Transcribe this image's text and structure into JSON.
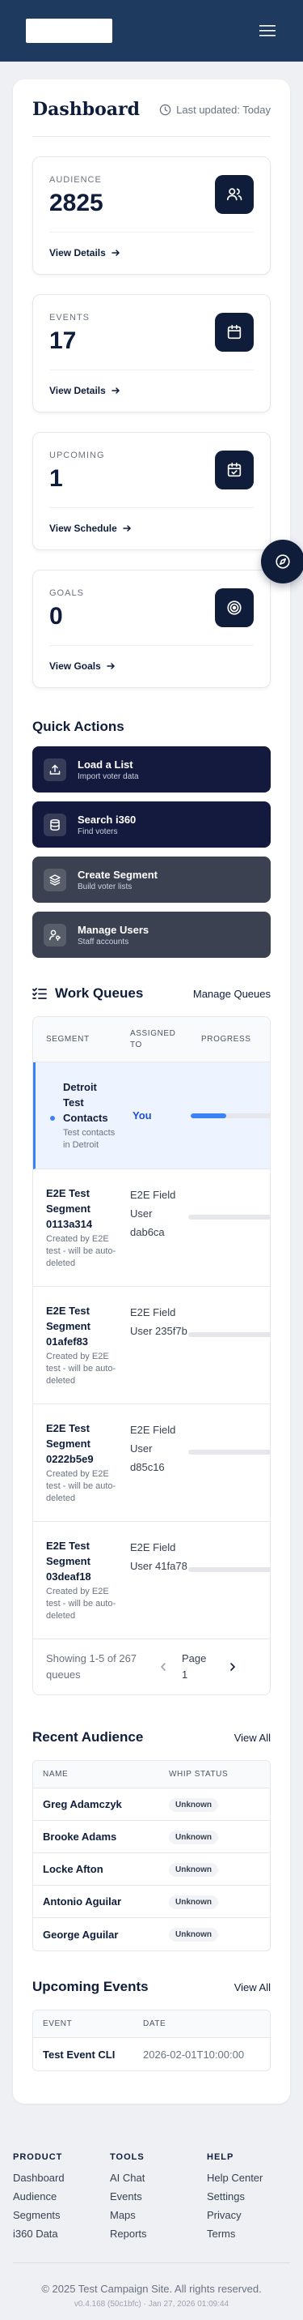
{
  "header": {
    "menu_icon": "hamburger-menu-icon"
  },
  "dashboard": {
    "title": "Dashboard",
    "last_updated": "Last updated: Today"
  },
  "stats": [
    {
      "label": "AUDIENCE",
      "value": "2825",
      "link": "View Details",
      "icon": "users-icon"
    },
    {
      "label": "EVENTS",
      "value": "17",
      "link": "View Details",
      "icon": "calendar-icon"
    },
    {
      "label": "UPCOMING",
      "value": "1",
      "link": "View Schedule",
      "icon": "calendar-check-icon"
    },
    {
      "label": "GOALS",
      "value": "0",
      "link": "View Goals",
      "icon": "target-icon"
    }
  ],
  "quick_actions": {
    "title": "Quick Actions",
    "items": [
      {
        "label": "Load a List",
        "sub": "Import voter data",
        "icon": "upload-icon"
      },
      {
        "label": "Search i360",
        "sub": "Find voters",
        "icon": "database-icon"
      },
      {
        "label": "Create Segment",
        "sub": "Build voter lists",
        "icon": "layers-icon"
      },
      {
        "label": "Manage Users",
        "sub": "Staff accounts",
        "icon": "user-key-icon"
      }
    ]
  },
  "work_queues": {
    "title": "Work Queues",
    "manage_link": "Manage Queues",
    "columns": [
      "SEGMENT",
      "ASSIGNED TO",
      "PROGRESS"
    ],
    "rows": [
      {
        "name": "Detroit Test Contacts",
        "desc": "Test contacts in Detroit",
        "assigned": "You",
        "progress": 0.45
      },
      {
        "name": "E2E Test Segment 0113a314",
        "desc": "Created by E2E test - will be auto-deleted",
        "assigned": "E2E Field User dab6ca",
        "progress": 0
      },
      {
        "name": "E2E Test Segment 01afef83",
        "desc": "Created by E2E test - will be auto-deleted",
        "assigned": "E2E Field User 235f7b",
        "progress": 0
      },
      {
        "name": "E2E Test Segment 0222b5e9",
        "desc": "Created by E2E test - will be auto-deleted",
        "assigned": "E2E Field User d85c16",
        "progress": 0
      },
      {
        "name": "E2E Test Segment 03deaf18",
        "desc": "Created by E2E test - will be auto-deleted",
        "assigned": "E2E Field User 41fa78",
        "progress": 0
      }
    ],
    "showing": "Showing 1-5 of 267 queues",
    "page": "Page 1"
  },
  "recent_audience": {
    "title": "Recent Audience",
    "view_all": "View All",
    "columns": [
      "NAME",
      "WHIP STATUS"
    ],
    "rows": [
      {
        "name": "Greg Adamczyk",
        "status": "Unknown"
      },
      {
        "name": "Brooke Adams",
        "status": "Unknown"
      },
      {
        "name": "Locke Afton",
        "status": "Unknown"
      },
      {
        "name": "Antonio Aguilar",
        "status": "Unknown"
      },
      {
        "name": "George Aguilar",
        "status": "Unknown"
      }
    ]
  },
  "upcoming_events": {
    "title": "Upcoming Events",
    "view_all": "View All",
    "columns": [
      "EVENT",
      "DATE"
    ],
    "rows": [
      {
        "name": "Test Event CLI",
        "date": "2026-02-01T10:00:00"
      }
    ]
  },
  "footer": {
    "cols": [
      {
        "heading": "PRODUCT",
        "links": [
          "Dashboard",
          "Audience",
          "Segments",
          "i360 Data"
        ]
      },
      {
        "heading": "TOOLS",
        "links": [
          "AI Chat",
          "Events",
          "Maps",
          "Reports"
        ]
      },
      {
        "heading": "HELP",
        "links": [
          "Help Center",
          "Settings",
          "Privacy",
          "Terms"
        ]
      }
    ],
    "copyright": "© 2025 Test Campaign Site. All rights reserved.",
    "version": "v0.4.168 (50c1bfc) · Jan 27, 2026 01:09:44"
  },
  "colors": {
    "navy": "#0f1d3a",
    "header": "#1e3a5f",
    "accent": "#3b82f6"
  }
}
